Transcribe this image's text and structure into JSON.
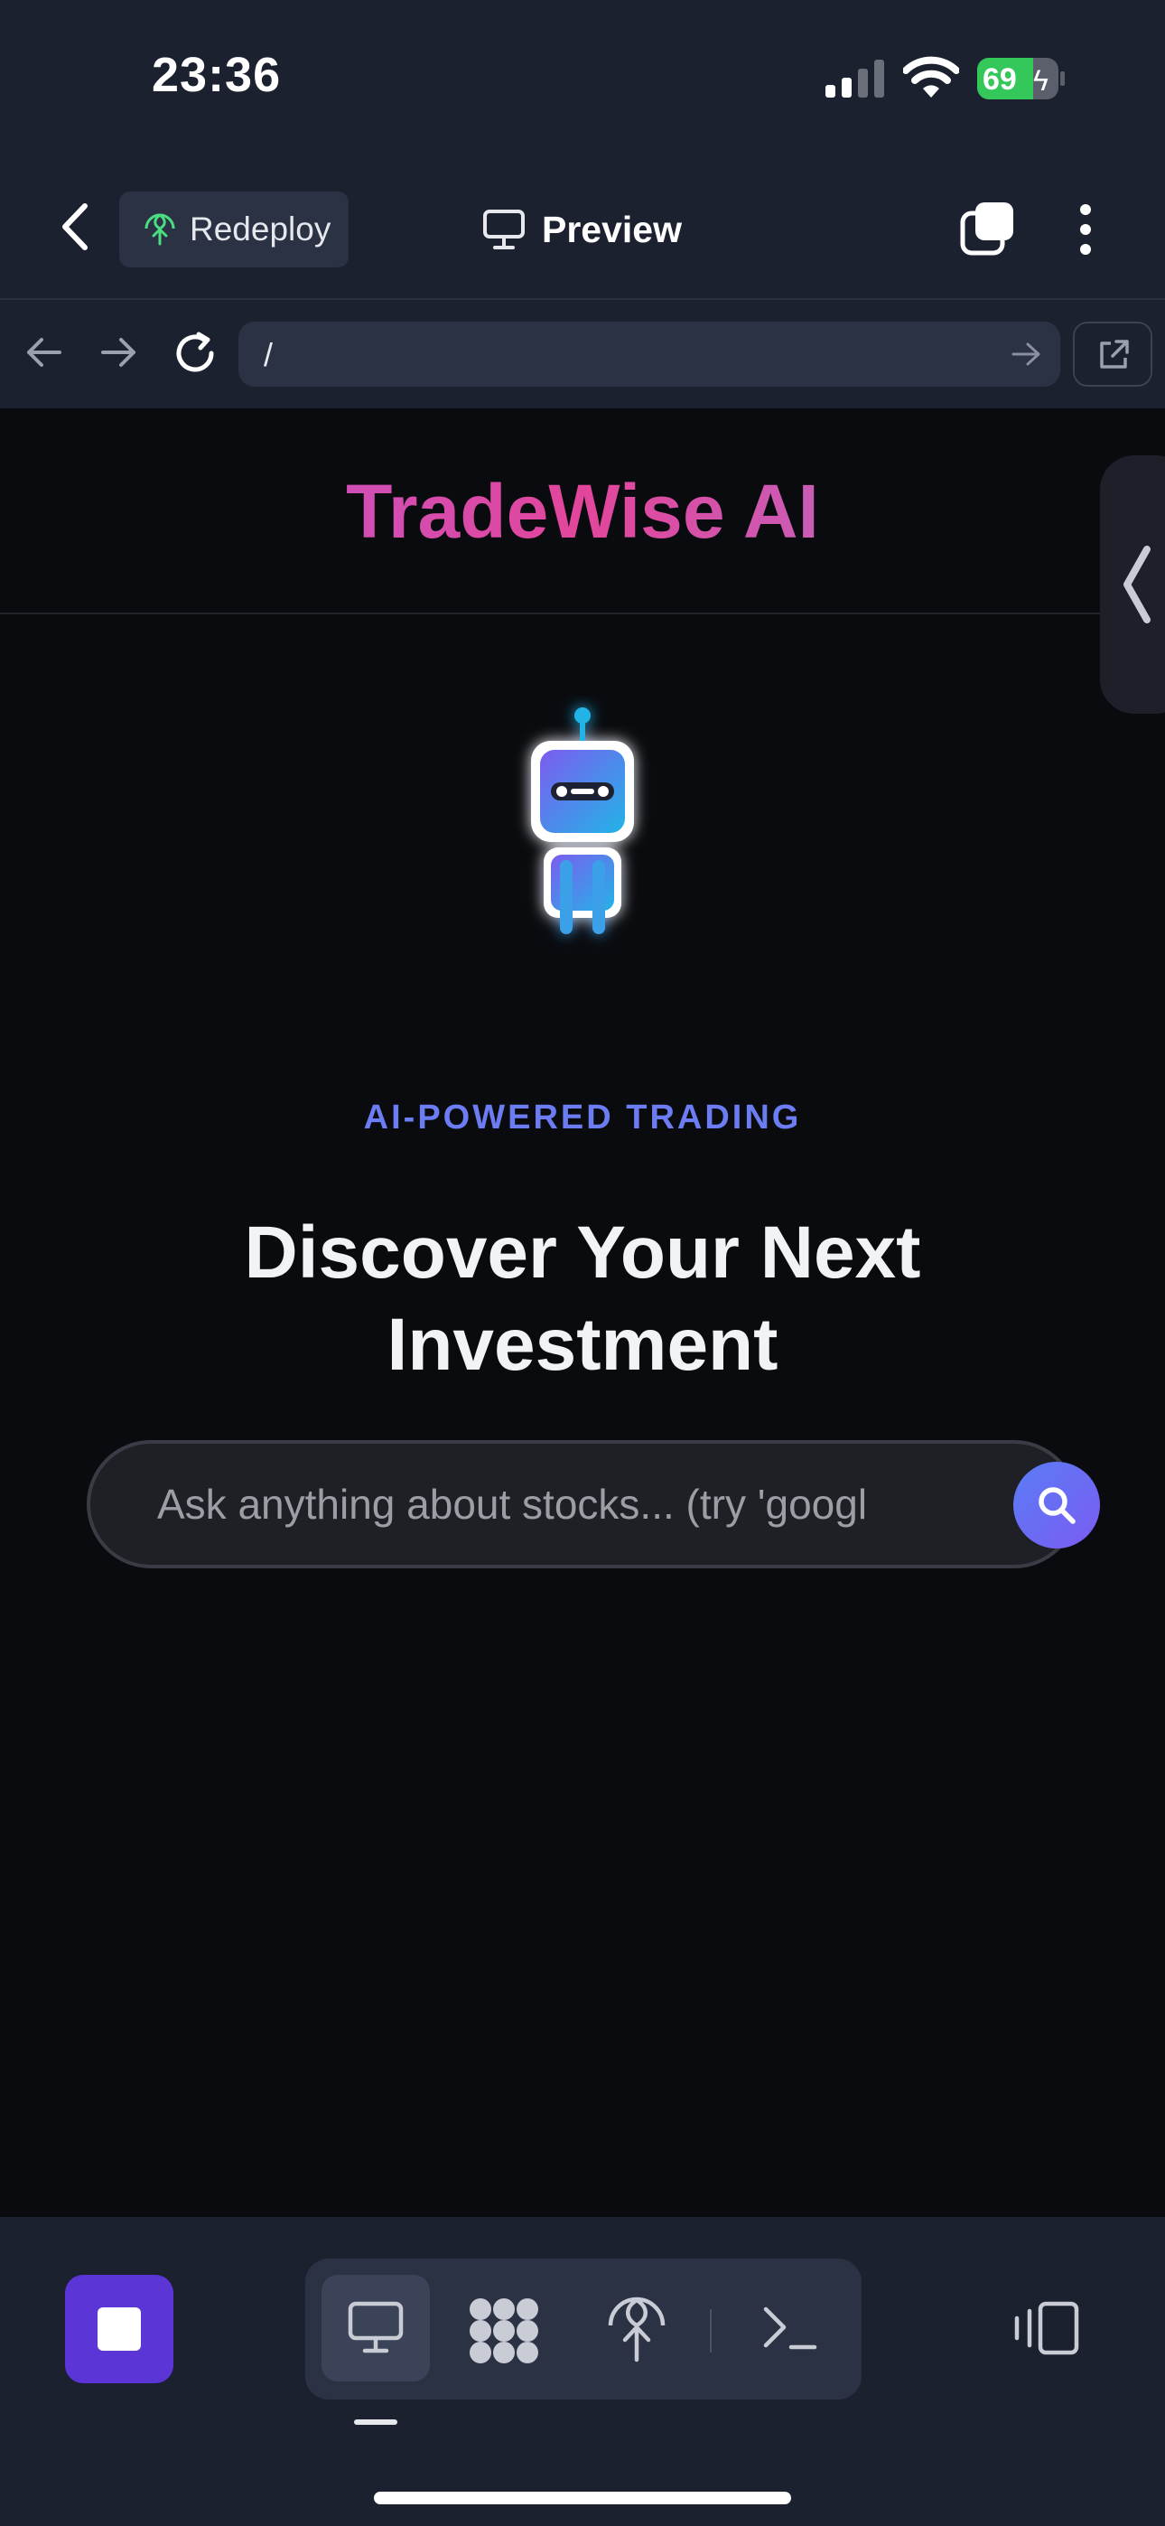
{
  "status_bar": {
    "time": "23:36",
    "battery": 69
  },
  "header": {
    "redeploy_label": "Redeploy",
    "preview_label": "Preview"
  },
  "browser": {
    "url": "/"
  },
  "page": {
    "brand": "TradeWise AI",
    "eyebrow": "AI-POWERED TRADING",
    "headline_line1": "Discover Your Next",
    "headline_line2": "Investment",
    "search_placeholder": "Ask anything about stocks... (try 'googl"
  },
  "colors": {
    "app_bg": "#1c2130",
    "page_bg": "#0a0b0f",
    "accent_purple": "#5b35d6",
    "eyebrow_blue": "#6c7cf2",
    "battery_green": "#34c759"
  },
  "icons": {
    "back": "chevron-left-icon",
    "redeploy": "globe-upload-icon",
    "preview": "monitor-icon",
    "tabs": "tabs-icon",
    "more": "more-vertical-icon",
    "reload": "reload-icon",
    "search": "search-icon",
    "stop": "stop-icon",
    "shell": "terminal-icon",
    "device": "device-toggle-icon"
  }
}
